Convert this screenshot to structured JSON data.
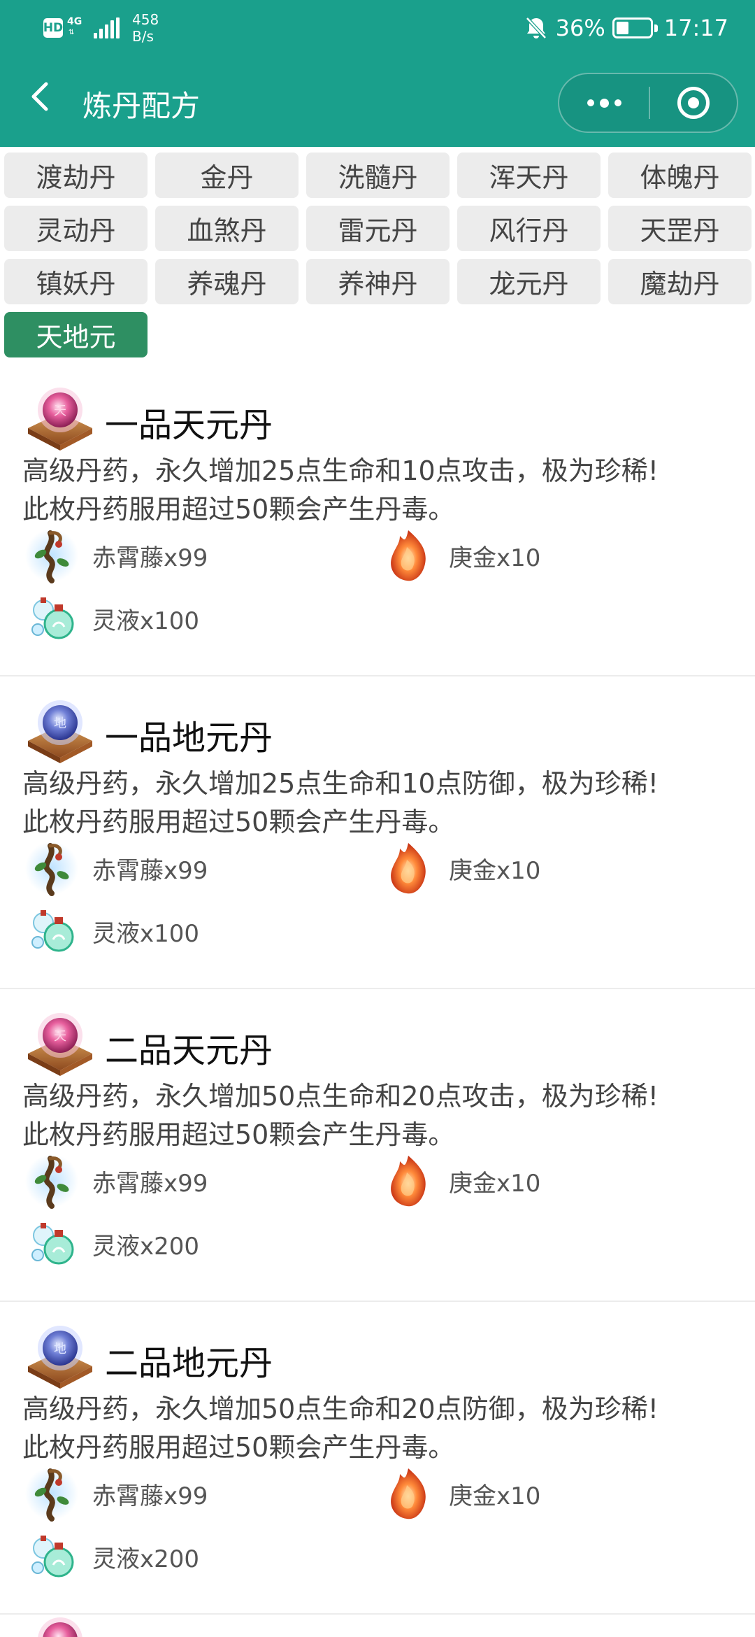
{
  "status_bar": {
    "hd": "HD",
    "network_type": "4G",
    "net_speed_value": "458",
    "net_speed_unit": "B/s",
    "battery_percent": "36%",
    "battery_level": 0.36,
    "time": "17:17"
  },
  "nav": {
    "title": "炼丹配方",
    "bg_color": "#1aa08c"
  },
  "categories": {
    "items": [
      "渡劫丹",
      "金丹",
      "洗髓丹",
      "浑天丹",
      "体魄丹",
      "灵动丹",
      "血煞丹",
      "雷元丹",
      "风行丹",
      "天罡丹",
      "镇妖丹",
      "养魂丹",
      "养神丹",
      "龙元丹",
      "魔劫丹",
      "天地元"
    ],
    "active": "天地元",
    "active_color": "#2e8f62"
  },
  "recipes": [
    {
      "icon": "tian-pill-icon",
      "title": "一品天元丹",
      "desc_line1": "高级丹药，永久增加25点生命和10点攻击，极为珍稀!",
      "desc_line2": "此枚丹药服用超过50颗会产生丹毒。",
      "materials": [
        {
          "icon": "vine-icon",
          "label": "赤霄藤x99"
        },
        {
          "icon": "flame-gem-icon",
          "label": "庚金x10"
        },
        {
          "icon": "spirit-liquid-icon",
          "label": "灵液x100"
        }
      ]
    },
    {
      "icon": "di-pill-icon",
      "title": "一品地元丹",
      "desc_line1": "高级丹药，永久增加25点生命和10点防御，极为珍稀!",
      "desc_line2": "此枚丹药服用超过50颗会产生丹毒。",
      "materials": [
        {
          "icon": "vine-icon",
          "label": "赤霄藤x99"
        },
        {
          "icon": "flame-gem-icon",
          "label": "庚金x10"
        },
        {
          "icon": "spirit-liquid-icon",
          "label": "灵液x100"
        }
      ]
    },
    {
      "icon": "tian-pill-icon",
      "title": "二品天元丹",
      "desc_line1": "高级丹药，永久增加50点生命和20点攻击，极为珍稀!",
      "desc_line2": "此枚丹药服用超过50颗会产生丹毒。",
      "materials": [
        {
          "icon": "vine-icon",
          "label": "赤霄藤x99"
        },
        {
          "icon": "flame-gem-icon",
          "label": "庚金x10"
        },
        {
          "icon": "spirit-liquid-icon",
          "label": "灵液x200"
        }
      ]
    },
    {
      "icon": "di-pill-icon",
      "title": "二品地元丹",
      "desc_line1": "高级丹药，永久增加50点生命和20点防御，极为珍稀!",
      "desc_line2": "此枚丹药服用超过50颗会产生丹毒。",
      "materials": [
        {
          "icon": "vine-icon",
          "label": "赤霄藤x99"
        },
        {
          "icon": "flame-gem-icon",
          "label": "庚金x10"
        },
        {
          "icon": "spirit-liquid-icon",
          "label": "灵液x200"
        }
      ]
    }
  ]
}
